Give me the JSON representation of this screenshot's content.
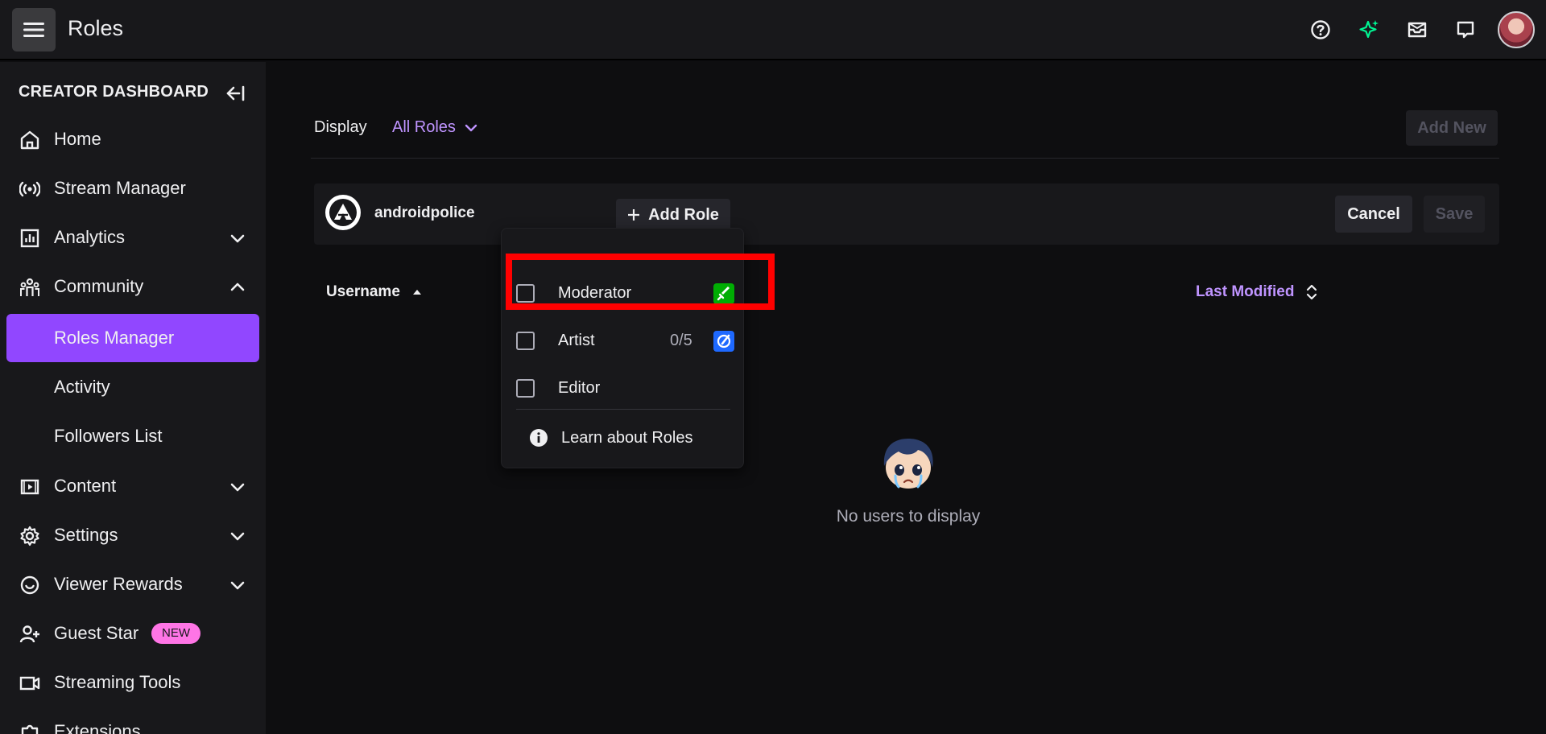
{
  "topbar": {
    "title": "Roles",
    "icons": [
      "help-icon",
      "sparkle-icon",
      "inbox-icon",
      "whispers-icon"
    ]
  },
  "sidebar": {
    "header": "CREATOR DASHBOARD",
    "items": [
      {
        "label": "Home",
        "icon": "home-icon"
      },
      {
        "label": "Stream Manager",
        "icon": "broadcast-icon"
      },
      {
        "label": "Analytics",
        "icon": "analytics-icon",
        "expandable": true
      },
      {
        "label": "Community",
        "icon": "community-icon",
        "expanded": true
      },
      {
        "label": "Roles Manager",
        "active": true
      },
      {
        "label": "Activity"
      },
      {
        "label": "Followers List"
      },
      {
        "label": "Content",
        "icon": "content-icon",
        "expandable": true
      },
      {
        "label": "Settings",
        "icon": "gear-icon",
        "expandable": true
      },
      {
        "label": "Viewer Rewards",
        "icon": "rewards-icon",
        "expandable": true
      },
      {
        "label": "Guest Star",
        "icon": "add-user-icon",
        "badge": "NEW"
      },
      {
        "label": "Streaming Tools",
        "icon": "camera-icon"
      },
      {
        "label": "Extensions",
        "icon": "puzzle-icon"
      }
    ]
  },
  "main": {
    "display_label": "Display",
    "filter_value": "All Roles",
    "add_new_label": "Add New",
    "user": {
      "name": "androidpolice"
    },
    "add_role_label": "Add Role",
    "cancel_label": "Cancel",
    "save_label": "Save",
    "columns": {
      "username": "Username",
      "last_modified": "Last Modified"
    },
    "empty_text": "No users to display"
  },
  "dropdown": {
    "items": [
      {
        "label": "Moderator",
        "count": "",
        "badge_color": "#00ad03",
        "badge_icon": "sword-icon"
      },
      {
        "label": "Artist",
        "count": "0/5",
        "badge_color": "#1e69ff",
        "badge_icon": "brush-icon"
      },
      {
        "label": "Editor",
        "count": ""
      }
    ],
    "learn_label": "Learn about Roles"
  },
  "colors": {
    "accent": "#9147ff",
    "accent_text": "#bf94ff",
    "highlight": "#ff0000",
    "badge_new": "#ff75e6"
  }
}
